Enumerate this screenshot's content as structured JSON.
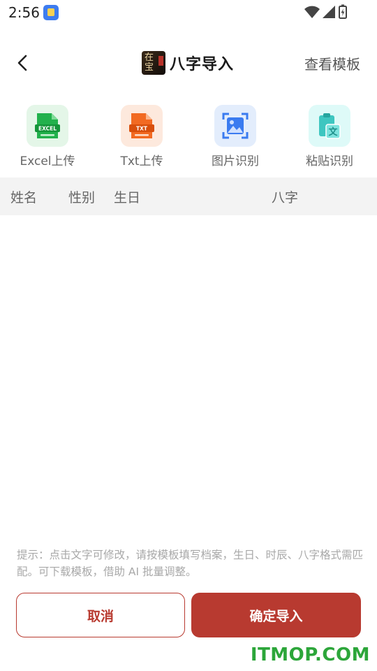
{
  "status_bar": {
    "time": "2:56"
  },
  "navbar": {
    "logo_text": "在\n宝",
    "title": "八字导入",
    "template_link": "查看模板"
  },
  "import_options": [
    {
      "label": "Excel上传",
      "icon": "excel-file-icon",
      "icon_text": "EXCEL",
      "color": "#22b14c",
      "bg": "#e4f6e8"
    },
    {
      "label": "Txt上传",
      "icon": "txt-file-icon",
      "icon_text": "TXT",
      "color": "#f26a22",
      "bg": "#fde9dd"
    },
    {
      "label": "图片识别",
      "icon": "image-scan-icon",
      "color": "#3a7bf0",
      "bg": "#e3edfc"
    },
    {
      "label": "粘贴识别",
      "icon": "clipboard-text-icon",
      "icon_text": "文",
      "color": "#3ec6c0",
      "bg": "#defaf8"
    }
  ],
  "table": {
    "columns": [
      "姓名",
      "性别",
      "生日",
      "八字"
    ]
  },
  "hint": "提示：点击文字可修改，请按模板填写档案，生日、时辰、八字格式需匹配。可下载模板，借助 AI 批量调整。",
  "buttons": {
    "cancel": "取消",
    "confirm": "确定导入"
  },
  "watermark": "ITMOP.COM",
  "colors": {
    "primary": "#b83a30",
    "header_bg": "#f3f3f3"
  }
}
